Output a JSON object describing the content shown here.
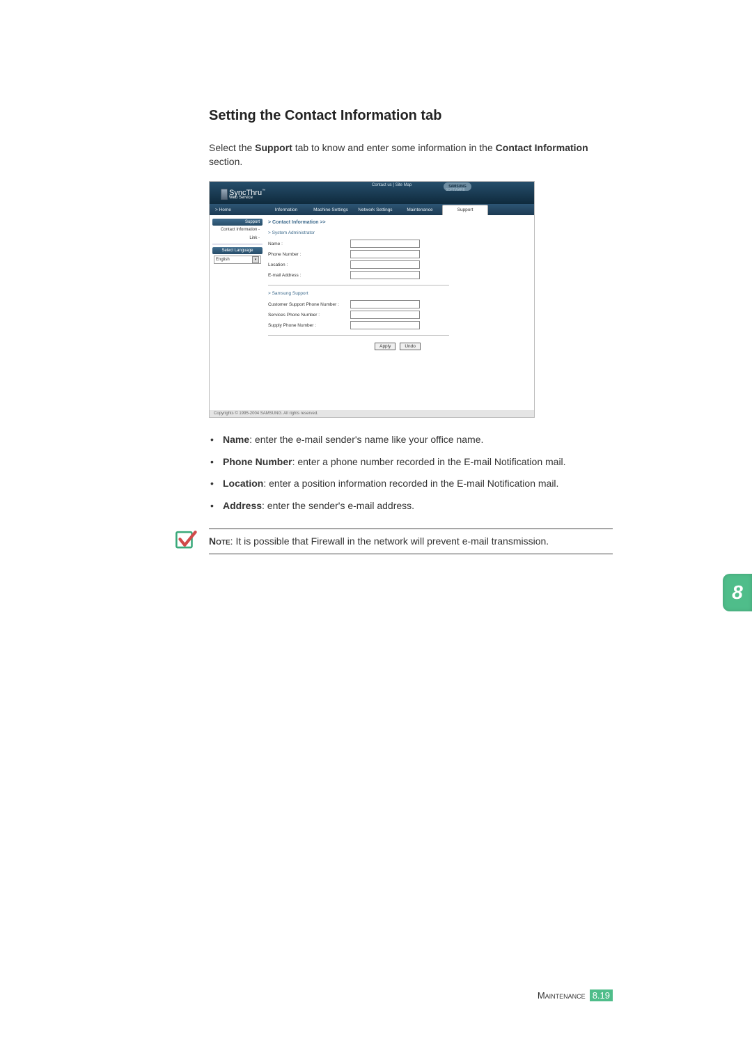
{
  "heading": "Setting the Contact Information tab",
  "intro_prefix": "Select the ",
  "intro_bold1": "Support",
  "intro_mid": " tab to know and enter some information in the ",
  "intro_bold2": "Contact Information",
  "intro_suffix": " section.",
  "webui": {
    "top_links": "Contact us  |  Site Map",
    "logo_text": "SAMSUNG",
    "logo_sub": "SOFTWARE",
    "brand_main": "SyncThru",
    "brand_tm": "™",
    "brand_sub": "Web Service",
    "tabs": {
      "home": "> Home",
      "items": [
        "Information",
        "Machine Settings",
        "Network Settings",
        "Maintenance",
        "Support"
      ],
      "active_index": 4
    },
    "sidebar": {
      "head": "Support",
      "items": [
        "Contact Information -",
        "Link -"
      ],
      "lang_head": "Select Language",
      "lang_value": "English"
    },
    "main": {
      "crumb": "> Contact Information >>",
      "sect1": "> System Administrator",
      "fields1": [
        {
          "label": "Name :"
        },
        {
          "label": "Phone Number :"
        },
        {
          "label": "Location :"
        },
        {
          "label": "E-mail Address :"
        }
      ],
      "sect2": "> Samsung Support",
      "fields2": [
        {
          "label": "Customer Support Phone Number :"
        },
        {
          "label": "Services Phone Number :"
        },
        {
          "label": "Supply Phone Number :"
        }
      ],
      "apply": "Apply",
      "undo": "Undo"
    },
    "footer": "Copyrights © 1995-2004 SAMSUNG. All rights reserved."
  },
  "bullets": [
    {
      "bold": "Name",
      "text": ": enter the e-mail sender's name like your office name."
    },
    {
      "bold": "Phone Number",
      "text": ": enter a phone number recorded in the E-mail Notification mail."
    },
    {
      "bold": "Location",
      "text": ": enter a position information recorded in the E-mail Notification mail."
    },
    {
      "bold": "Address",
      "text": ": enter the sender's e-mail address."
    }
  ],
  "note": {
    "label": "Note",
    "text": ": It is possible that Firewall in the network will prevent e-mail transmission."
  },
  "side_tab": "8",
  "footer": {
    "label": "Maintenance",
    "page": "8.19"
  }
}
